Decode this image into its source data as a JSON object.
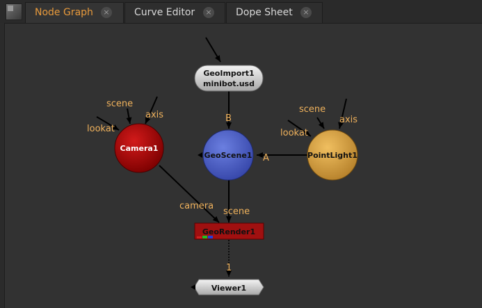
{
  "tabs": [
    {
      "label": "Node Graph",
      "active": true
    },
    {
      "label": "Curve Editor",
      "active": false
    },
    {
      "label": "Dope Sheet",
      "active": false
    }
  ],
  "tab_close_icon": "×",
  "nodes": {
    "geoimport": {
      "name": "GeoImport1",
      "file": "minibot.usd",
      "color": "#d9d9d9"
    },
    "camera": {
      "name": "Camera1",
      "color": "#a00000"
    },
    "geoscene": {
      "name": "GeoScene1",
      "color": "#4f62c8"
    },
    "pointlight": {
      "name": "PointLight1",
      "color": "#d9a040"
    },
    "georender": {
      "name": "GeoRender1",
      "color": "#a01010"
    },
    "viewer": {
      "name": "Viewer1",
      "color": "#cfcfcf"
    }
  },
  "port_labels": {
    "camera_scene": "scene",
    "camera_axis": "axis",
    "camera_lookat": "lookat",
    "light_scene": "scene",
    "light_axis": "axis",
    "light_lookat": "lookat",
    "geoscene_b": "B",
    "geoscene_a": "A",
    "render_camera": "camera",
    "render_scene": "scene",
    "viewer_input": "1"
  },
  "colors": {
    "accent_tab": "#e89a3c",
    "label": "#f0b25c",
    "background": "#323232"
  }
}
